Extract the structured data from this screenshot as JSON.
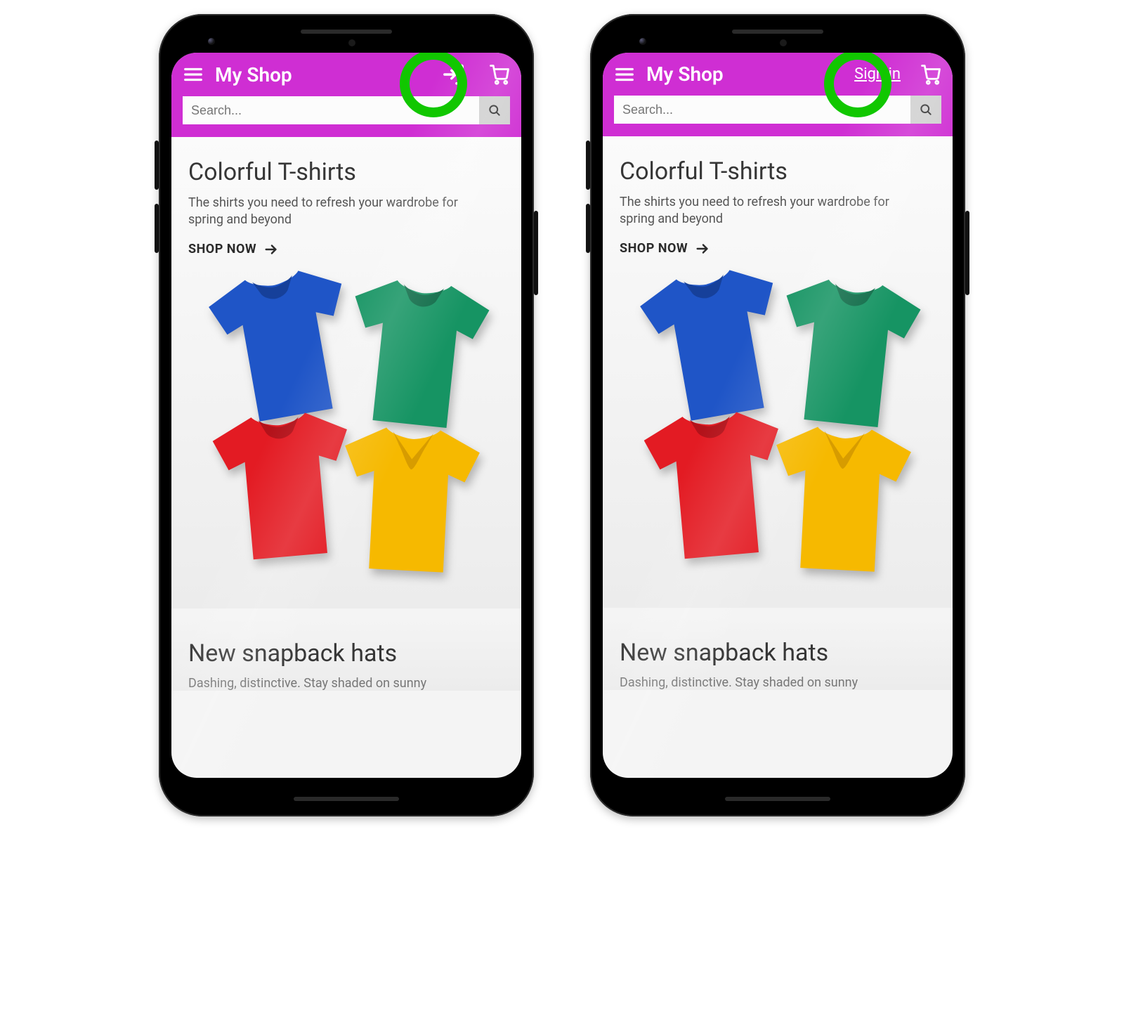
{
  "header": {
    "title": "My Shop",
    "signin_label": "Sign in",
    "search_placeholder": "Search..."
  },
  "hero": {
    "heading": "Colorful T-shirts",
    "sub": "The shirts you need to refresh your wardrobe for spring and beyond",
    "cta": "SHOP NOW"
  },
  "second": {
    "heading": "New snapback hats",
    "sub_partial": "Dashing, distinctive. Stay shaded on sunny"
  },
  "colors": {
    "accent": "#cf2ed3",
    "highlight": "#11c700",
    "shirt_blue": "#1f55c7",
    "shirt_green": "#169463",
    "shirt_red": "#e31b23",
    "shirt_yellow": "#f6b900"
  }
}
